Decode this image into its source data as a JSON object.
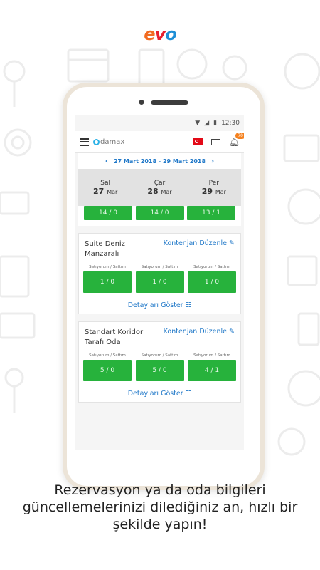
{
  "logo": {
    "e": "e",
    "v": "v",
    "o": "o"
  },
  "status_bar": {
    "time": "12:30"
  },
  "app": {
    "brand": "damax",
    "notification_count": "70"
  },
  "date_range": {
    "label": "27 Mart 2018 - 29 Mart 2018",
    "prev": "‹",
    "next": "›"
  },
  "days": [
    {
      "name": "Sal",
      "day": "27",
      "month": "Mar"
    },
    {
      "name": "Çar",
      "day": "28",
      "month": "Mar"
    },
    {
      "name": "Per",
      "day": "29",
      "month": "Mar"
    }
  ],
  "top_values": [
    "14 / 0",
    "14 / 0",
    "13 / 1"
  ],
  "rooms": [
    {
      "name": "Suite Deniz Manzaralı",
      "edit": "Kontenjan Düzenle",
      "col_label": "Satıyorum / Sattım",
      "values": [
        "1 / 0",
        "1 / 0",
        "1 / 0"
      ],
      "details": "Detayları Göster"
    },
    {
      "name": "Standart Koridor Tarafı Oda",
      "edit": "Kontenjan Düzenle",
      "col_label": "Satıyorum / Sattım",
      "values": [
        "5 / 0",
        "5 / 0",
        "4 / 1"
      ],
      "details": "Detayları Göster"
    }
  ],
  "caption": "Rezervasyon ya da oda bilgileri güncellemelerinizi dilediğiniz an, hızlı bir şekilde yapın!",
  "colors": {
    "green": "#27b23c",
    "link": "#2078c8",
    "badge": "#f58220"
  }
}
